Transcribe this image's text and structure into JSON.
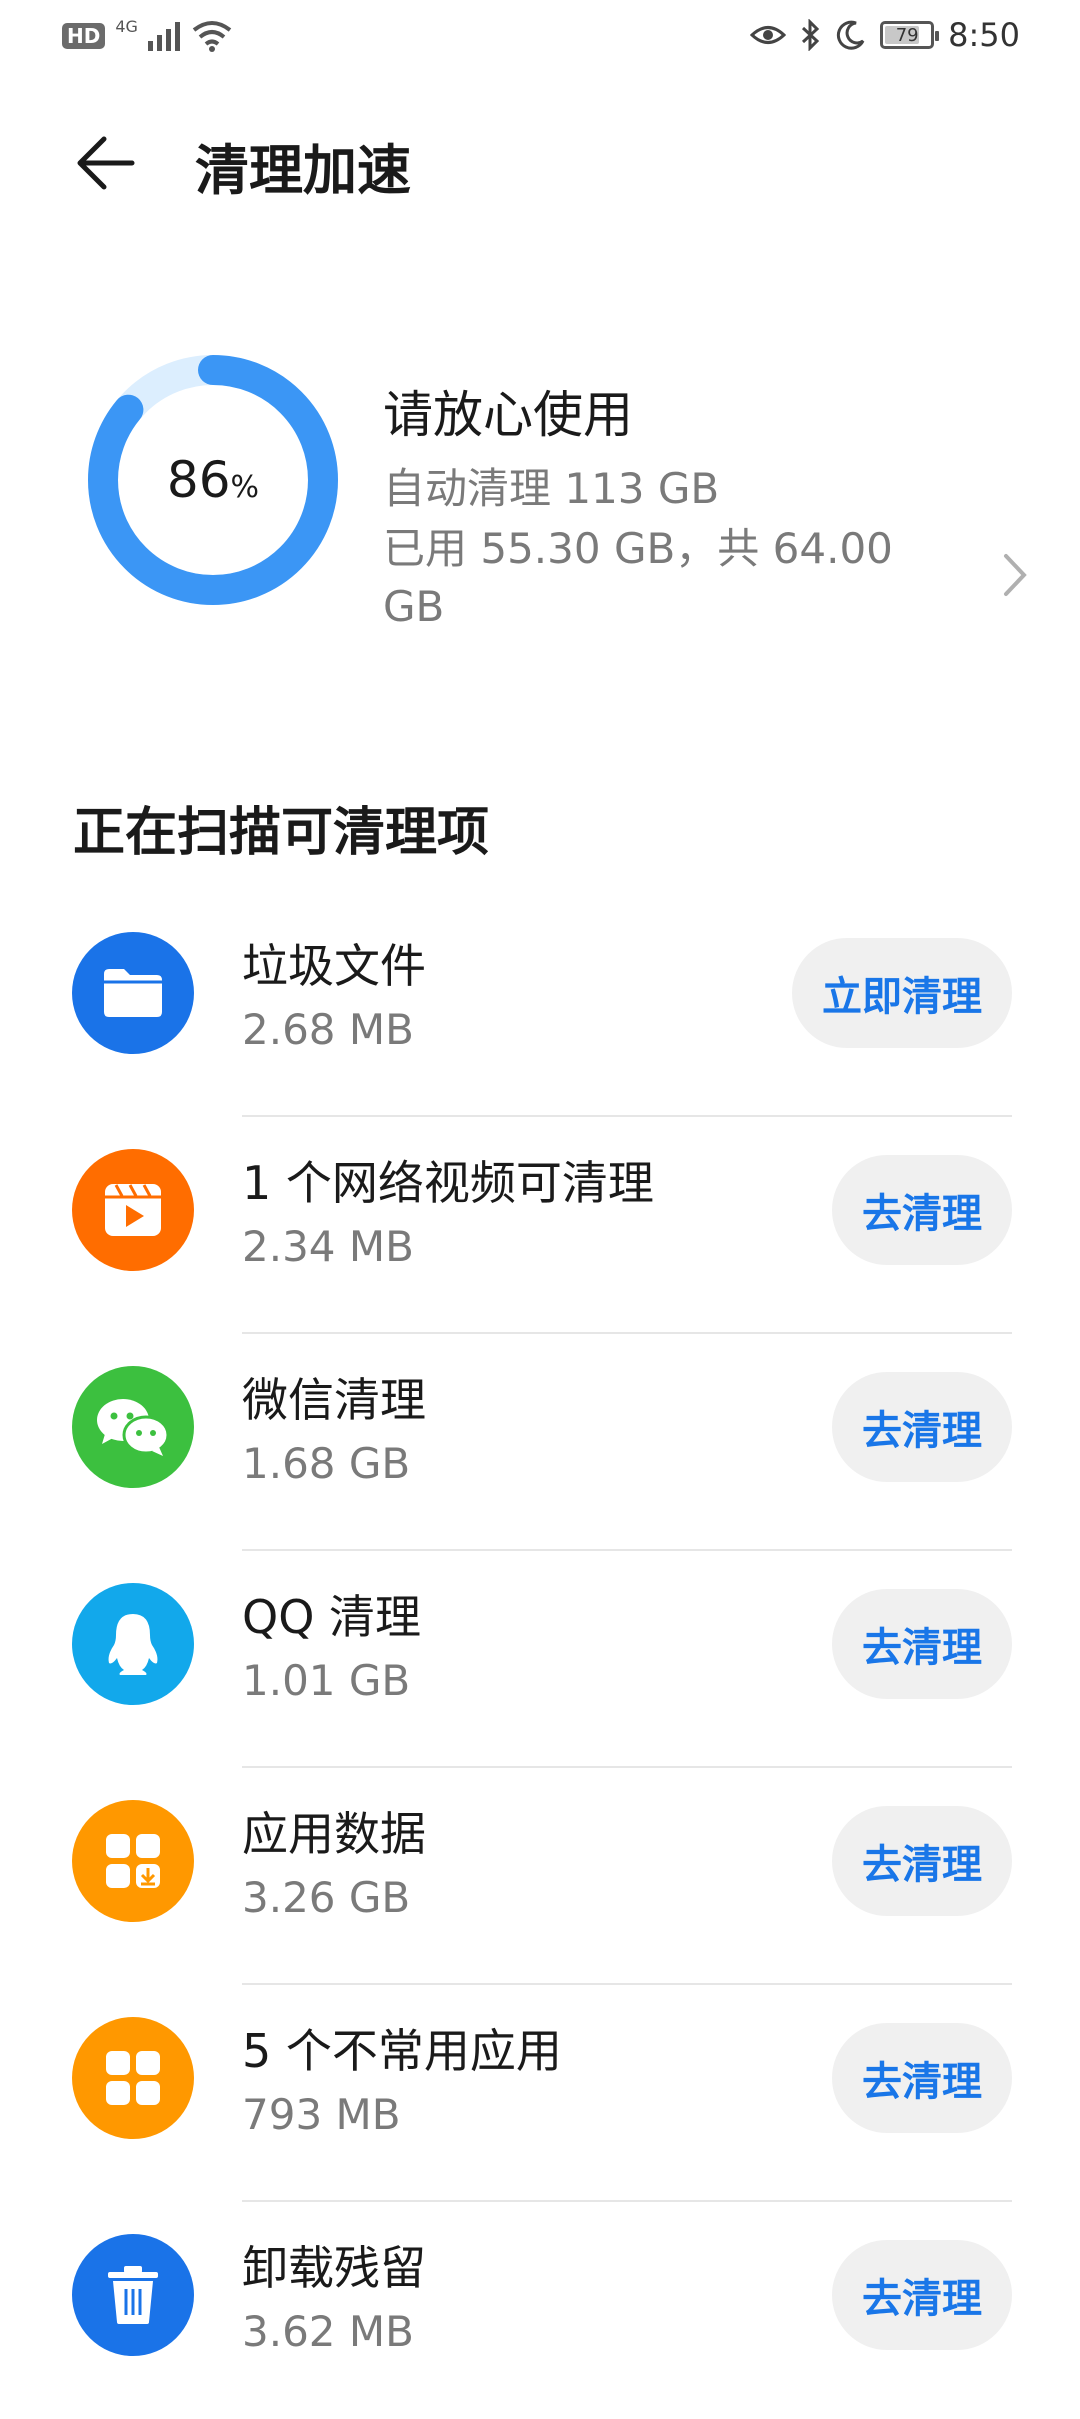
{
  "status_bar": {
    "hd": "HD",
    "network": "4G",
    "battery": "79",
    "battery_level": 0.79,
    "time": "8:50"
  },
  "header": {
    "title": "清理加速"
  },
  "summary": {
    "percent": "86",
    "percent_value": 86,
    "percent_sign": "%",
    "title": "请放心使用",
    "auto_clean": "自动清理 113 GB",
    "usage": "已用 55.30 GB，共 64.00 GB"
  },
  "section": {
    "title": "正在扫描可清理项"
  },
  "items": [
    {
      "title": "垃圾文件",
      "size": "2.68 MB",
      "button": "立即清理",
      "icon": "folder-icon",
      "color": "#1a73e8"
    },
    {
      "title": "1 个网络视频可清理",
      "size": "2.34 MB",
      "button": "去清理",
      "icon": "video-icon",
      "color": "#ff6d00"
    },
    {
      "title": "微信清理",
      "size": "1.68 GB",
      "button": "去清理",
      "icon": "wechat-icon",
      "color": "#3cc03f"
    },
    {
      "title": "QQ 清理",
      "size": "1.01 GB",
      "button": "去清理",
      "icon": "qq-icon",
      "color": "#12a8eb"
    },
    {
      "title": "应用数据",
      "size": "3.26 GB",
      "button": "去清理",
      "icon": "app-data-icon",
      "color": "#ff9800"
    },
    {
      "title": "5 个不常用应用",
      "size": "793 MB",
      "button": "去清理",
      "icon": "apps-icon",
      "color": "#ff9800"
    },
    {
      "title": "卸载残留",
      "size": "3.62 MB",
      "button": "去清理",
      "icon": "trash-icon",
      "color": "#1a73e8"
    }
  ],
  "colors": {
    "accent": "#1976e8",
    "ring": "#3b96f5",
    "ring_track": "#dceefe"
  }
}
